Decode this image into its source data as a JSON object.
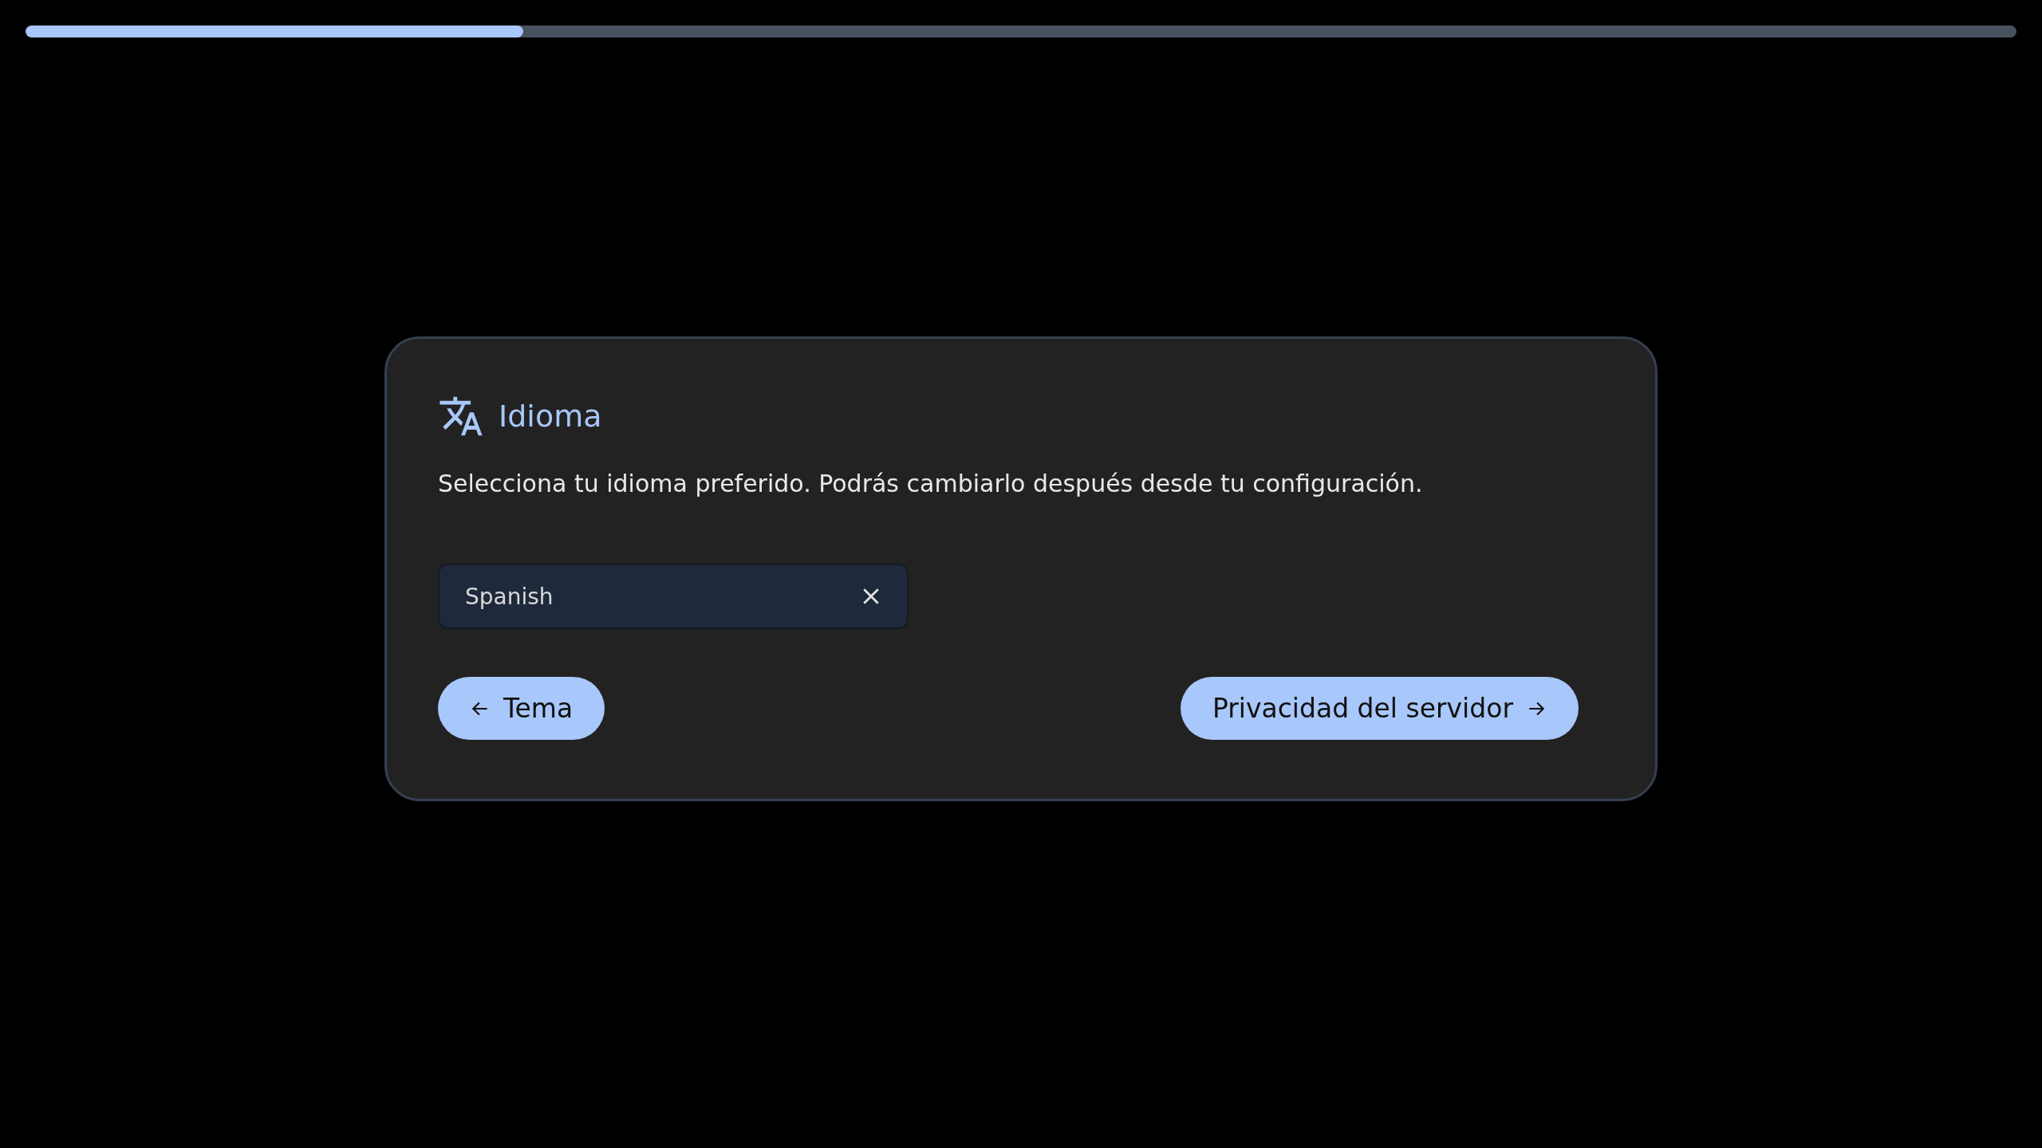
{
  "progress": {
    "level": 0.25
  },
  "dialog": {
    "title": "Idioma",
    "description": "Selecciona tu idioma preferido. Podrás cambiarlo después desde tu configuración.",
    "language_field": {
      "value": "Spanish"
    },
    "buttons": [
      {
        "kind": "back",
        "label": "Tema"
      },
      {
        "kind": "next",
        "label": "Privacidad del servidor"
      }
    ]
  }
}
